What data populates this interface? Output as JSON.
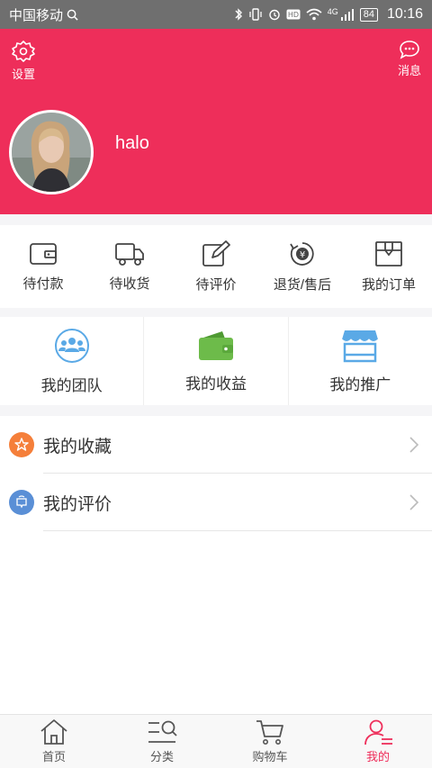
{
  "status_bar": {
    "carrier": "中国移动",
    "network": "4G",
    "battery": "84",
    "time": "10:16"
  },
  "header": {
    "settings_label": "设置",
    "messages_label": "消息",
    "username": "halo",
    "background_color": "#ee2e5a"
  },
  "orders": [
    {
      "label": "待付款",
      "icon": "wallet-icon"
    },
    {
      "label": "待收货",
      "icon": "truck-icon"
    },
    {
      "label": "待评价",
      "icon": "edit-icon"
    },
    {
      "label": "退货/售后",
      "icon": "refund-icon"
    },
    {
      "label": "我的订单",
      "icon": "order-box-icon"
    }
  ],
  "features": [
    {
      "label": "我的团队",
      "icon": "team-icon",
      "color": "#5aa9e6"
    },
    {
      "label": "我的收益",
      "icon": "green-wallet-icon",
      "color": "#6dbb4a"
    },
    {
      "label": "我的推广",
      "icon": "shop-icon",
      "color": "#5aa9e6"
    }
  ],
  "menu": [
    {
      "label": "我的收藏",
      "icon": "star-icon",
      "color": "#f57f3a"
    },
    {
      "label": "我的评价",
      "icon": "comment-icon",
      "color": "#5a8fd6"
    }
  ],
  "tabbar": [
    {
      "label": "首页",
      "icon": "home-icon",
      "active": false
    },
    {
      "label": "分类",
      "icon": "category-icon",
      "active": false
    },
    {
      "label": "购物车",
      "icon": "cart-icon",
      "active": false
    },
    {
      "label": "我的",
      "icon": "user-icon",
      "active": true
    }
  ],
  "colors": {
    "accent": "#ee2e5a",
    "text": "#333333",
    "divider": "#eeeeee"
  }
}
